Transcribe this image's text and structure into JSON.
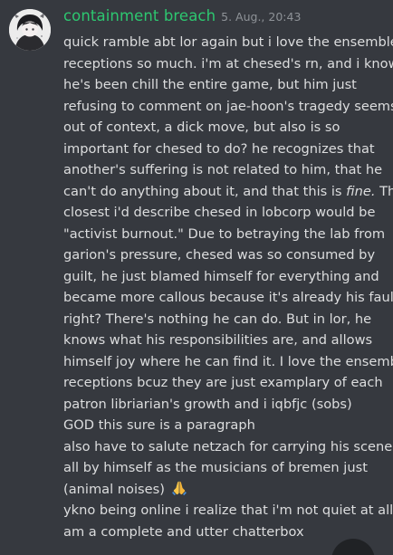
{
  "message": {
    "author": "containment breach",
    "timestamp": "5. Aug., 20:43",
    "author_color": "#2dc770",
    "lines": [
      "quick ramble abt lor again but i love the ensemble",
      "receptions so much. i'm at chesed's rn, and i know",
      "he's been chill the entire game, but him just",
      "refusing to comment on jae-hoon's tragedy seems,",
      "out of context, a dick move, but also is so",
      "important for chesed to do? he recognizes that",
      "another's suffering is not related to him, that he",
      "can't do anything about it, and that this is ",
      "closest i'd describe chesed in lobcorp would be",
      "\"activist burnout.\" Due to betraying the lab from",
      "garion's pressure, chesed was so consumed by",
      "guilt, he just blamed himself for everything and",
      "became more callous because it's already his fault,",
      "right? There's nothing he can do. But in lor, he",
      "knows what his responsibilities are, and allows",
      "himself joy where he can find it. I love the ensemble",
      "receptions bcuz they are just examplary of each",
      "patron libriarian's growth and i iqbfjc (sobs)",
      "GOD this sure is a paragraph",
      "also have to salute netzach for carrying his scene",
      "all by himself as the musicians of bremen just",
      "(animal noises) ",
      "ykno being online i realize that i'm not quiet at all i",
      "am a complete and utter chatterbox"
    ],
    "line8_italic": "fine.",
    "line8_tail": " The",
    "emoji": "folded-hands-emoji"
  }
}
